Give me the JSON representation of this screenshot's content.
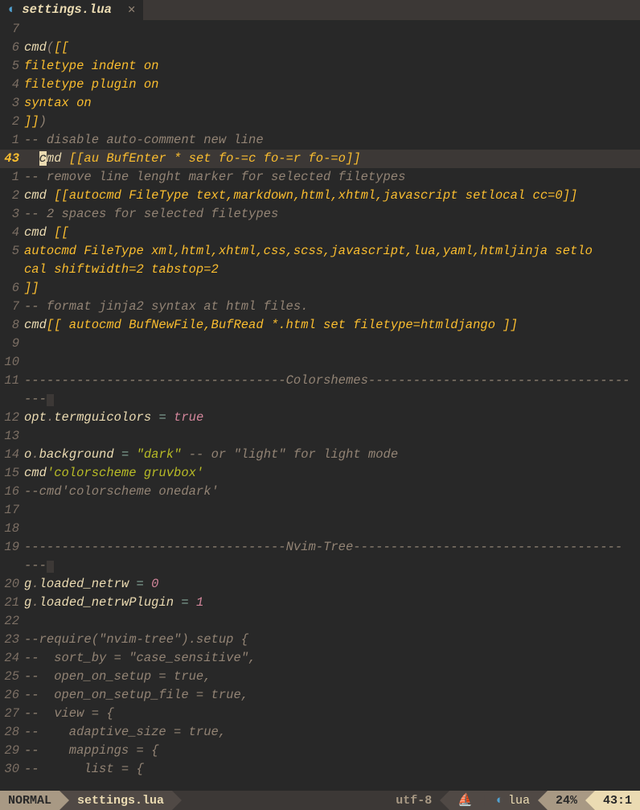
{
  "tab": {
    "icon": "◐",
    "title": "settings.lua",
    "close": "✕"
  },
  "gutter": [
    "7",
    "6",
    "5",
    "4",
    "3",
    "2",
    "1",
    "43",
    "1",
    "2",
    "3",
    "4",
    "5",
    "",
    "6",
    "7",
    "8",
    "9",
    "10",
    "11",
    "",
    "12",
    "13",
    "14",
    "15",
    "16",
    "17",
    "18",
    "19",
    "",
    "20",
    "21",
    "22",
    "23",
    "24",
    "25",
    "26",
    "27",
    "28",
    "29",
    "30"
  ],
  "lines": {
    "l0": "",
    "l1a": "cmd",
    "l1b": "(",
    "l1c": "[[",
    "l2": "filetype indent on",
    "l3": "filetype plugin on",
    "l4": "syntax on",
    "l5a": "]]",
    "l5b": ")",
    "l6": "-- disable auto-comment new line",
    "l7a": "c",
    "l7b": "md ",
    "l7c": "[[au BufEnter * set fo-=c fo-=r fo-=o]]",
    "l8": "-- remove line lenght marker for selected filetypes",
    "l9a": "cmd ",
    "l9b": "[[autocmd FileType text,markdown,html,xhtml,javascript setlocal cc=0]]",
    "l10": "-- 2 spaces for selected filetypes",
    "l11a": "cmd ",
    "l11b": "[[",
    "l12": "autocmd FileType xml,html,xhtml,css,scss,javascript,lua,yaml,htmljinja setlo",
    "l12b": "cal shiftwidth=2 tabstop=2",
    "l13": "]]",
    "l14": "-- format jinja2 syntax at html files.",
    "l15a": "cmd",
    "l15b": "[[ autocmd BufNewFile,BufRead *.html set filetype=htmldjango ]]",
    "l16": "",
    "l17": "",
    "l18a": "-----------------------------------",
    "l18b": "Colorshemes",
    "l18c": "-----------------------------------",
    "l18d": "---",
    "l19a": "opt",
    "l19b": ".",
    "l19c": "termguicolors ",
    "l19d": "=",
    "l19e": " true",
    "l20": "",
    "l21a": "o",
    "l21b": ".",
    "l21c": "background ",
    "l21d": "=",
    "l21e": " \"dark\"",
    "l21f": " -- or \"light\" for light mode",
    "l22a": "cmd",
    "l22b": "'colorscheme gruvbox'",
    "l23": "--cmd'colorscheme onedark'",
    "l24": "",
    "l25": "",
    "l26a": "-----------------------------------",
    "l26b": "Nvim-Tree",
    "l26c": "------------------------------------",
    "l26d": "---",
    "l27a": "g",
    "l27b": ".",
    "l27c": "loaded_netrw ",
    "l27d": "=",
    "l27e": " 0",
    "l28a": "g",
    "l28b": ".",
    "l28c": "loaded_netrwPlugin ",
    "l28d": "=",
    "l28e": " 1",
    "l29": "",
    "l30": "--require(\"nvim-tree\").setup {",
    "l31": "--  sort_by = \"case_sensitive\",",
    "l32": "--  open_on_setup = true,",
    "l33": "--  open_on_setup_file = true,",
    "l34": "--  view = {",
    "l35": "--    adaptive_size = true,",
    "l36": "--    mappings = {",
    "l37": "--      list = {"
  },
  "status": {
    "mode": "NORMAL",
    "file": "settings.lua",
    "encoding": "utf-8",
    "os_icon": "⛵",
    "ft_icon": "◐",
    "ft": "lua",
    "percent": "24%",
    "pos": "43:1"
  }
}
